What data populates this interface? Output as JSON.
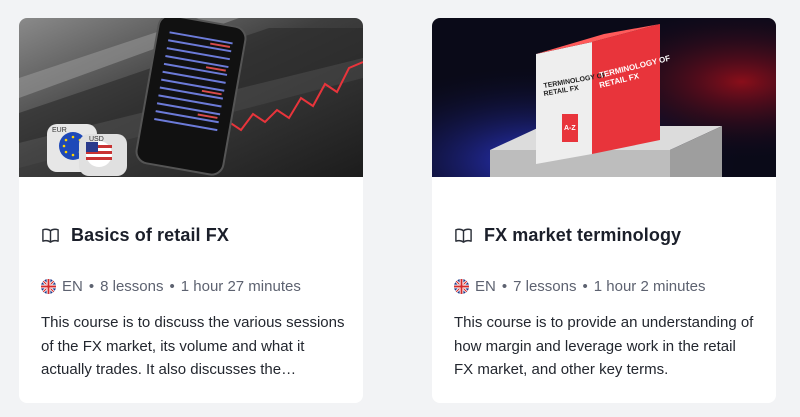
{
  "courses": [
    {
      "title": "Basics of retail FX",
      "language": "EN",
      "lessons": "8 lessons",
      "duration": "1 hour 27 minutes",
      "description": "This course is to discuss the various sessions of the FX market, its volume and what it actually trades. It also discusses the participants of the market.",
      "image": {
        "icon_names": [
          "phone-quotes-icon",
          "eur-coin-icon",
          "usd-coin-icon"
        ],
        "eur_label": "EUR",
        "usd_label": "USD"
      }
    },
    {
      "title": "FX market terminology",
      "language": "EN",
      "lessons": "7 lessons",
      "duration": "1 hour 2 minutes",
      "description": "This course is to provide an understanding of how margin and leverage work in the retail FX market, and other key terms.",
      "image": {
        "icon_names": [
          "book-box-icon"
        ],
        "book_title": "TERMINOLOGY OF RETAIL FX",
        "book_spine": "A-Z"
      }
    }
  ],
  "meta_separator": "•",
  "colors": {
    "page_bg": "#f2f3f5",
    "card_bg": "#ffffff",
    "accent_red": "#e8343b"
  }
}
